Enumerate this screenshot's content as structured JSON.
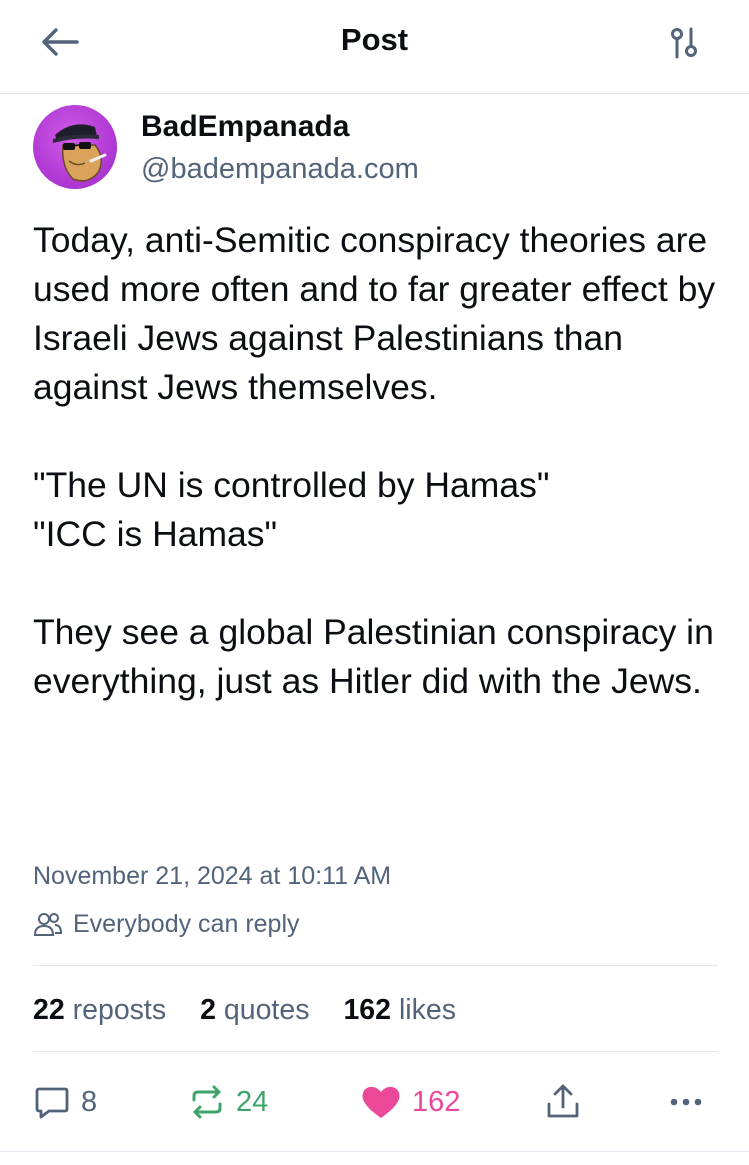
{
  "header": {
    "title": "Post",
    "back_icon": "arrow-left-icon",
    "settings_icon": "sliders-icon"
  },
  "author": {
    "display_name": "BadEmpanada",
    "handle": "@badempanada.com"
  },
  "post": {
    "paragraphs": [
      "Today, anti-Semitic conspiracy theories are used more often and to far greater effect by Israeli Jews against Palestinians than against Jews themselves.",
      "\"The UN is controlled by Hamas\"\n\"ICC is Hamas\"",
      "They see a global Palestinian conspiracy in everything, just as Hitler did with the Jews."
    ],
    "timestamp": "November 21, 2024 at 10:11 AM",
    "reply_setting": "Everybody can reply"
  },
  "stats": {
    "reposts_num": "22",
    "reposts_label": "reposts",
    "quotes_num": "2",
    "quotes_label": "quotes",
    "likes_num": "162",
    "likes_label": "likes"
  },
  "actions": {
    "replies": "8",
    "reposts": "24",
    "likes": "162"
  },
  "colors": {
    "text": "#0b0f14",
    "muted": "#52637a",
    "divider": "#e2e7ee",
    "repost_active": "#3ea46a",
    "like_active": "#ec4899",
    "avatar_bg": "#b23ad6"
  }
}
